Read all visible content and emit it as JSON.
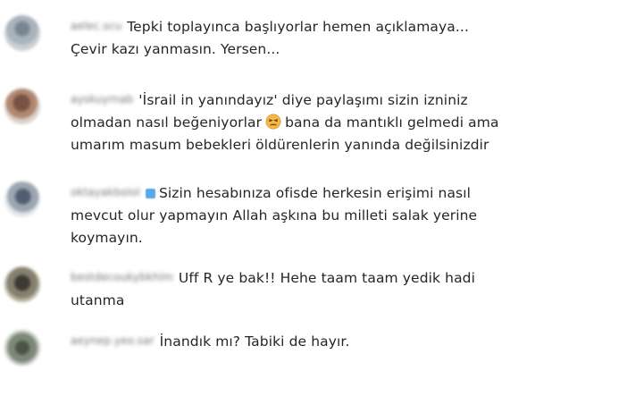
{
  "comments": [
    {
      "username": "aelec.scu",
      "verified": false,
      "lines": [
        "Tepki toplayınca başlıyorlar hemen açıklamaya...",
        "Çevir kazı yanmasın. Yersen..."
      ]
    },
    {
      "username": "ayskuyrnab",
      "verified": false,
      "lines_before_emoji": "'İsrail in yanındayız' diye paylaşımı sizin izniniz",
      "line2_before_emoji": "olmadan nasıl beğeniyorlar",
      "emoji_icon": "persevering-face-icon",
      "line2_after_emoji": "bana da mantıklı gelmedi ama",
      "line3": "umarım masum bebekleri öldürenlerin yanında değilsinizdir"
    },
    {
      "username": "oktayakbolol",
      "verified": true,
      "lines": [
        "Sizin hesabınıza ofisde herkesin erişimi nasıl",
        "mevcut olur yapmayın Allah aşkına bu milleti salak yerine",
        "koymayın."
      ]
    },
    {
      "username": "bestdecoukybkhlm",
      "verified": false,
      "lines": [
        "Uff R ye bak!! Hehe taam taam yedik hadi",
        "utanma"
      ]
    },
    {
      "username": "aeynep.yeo.sar",
      "verified": false,
      "lines": [
        "İnandık mı? Tabiki de hayır."
      ]
    }
  ]
}
